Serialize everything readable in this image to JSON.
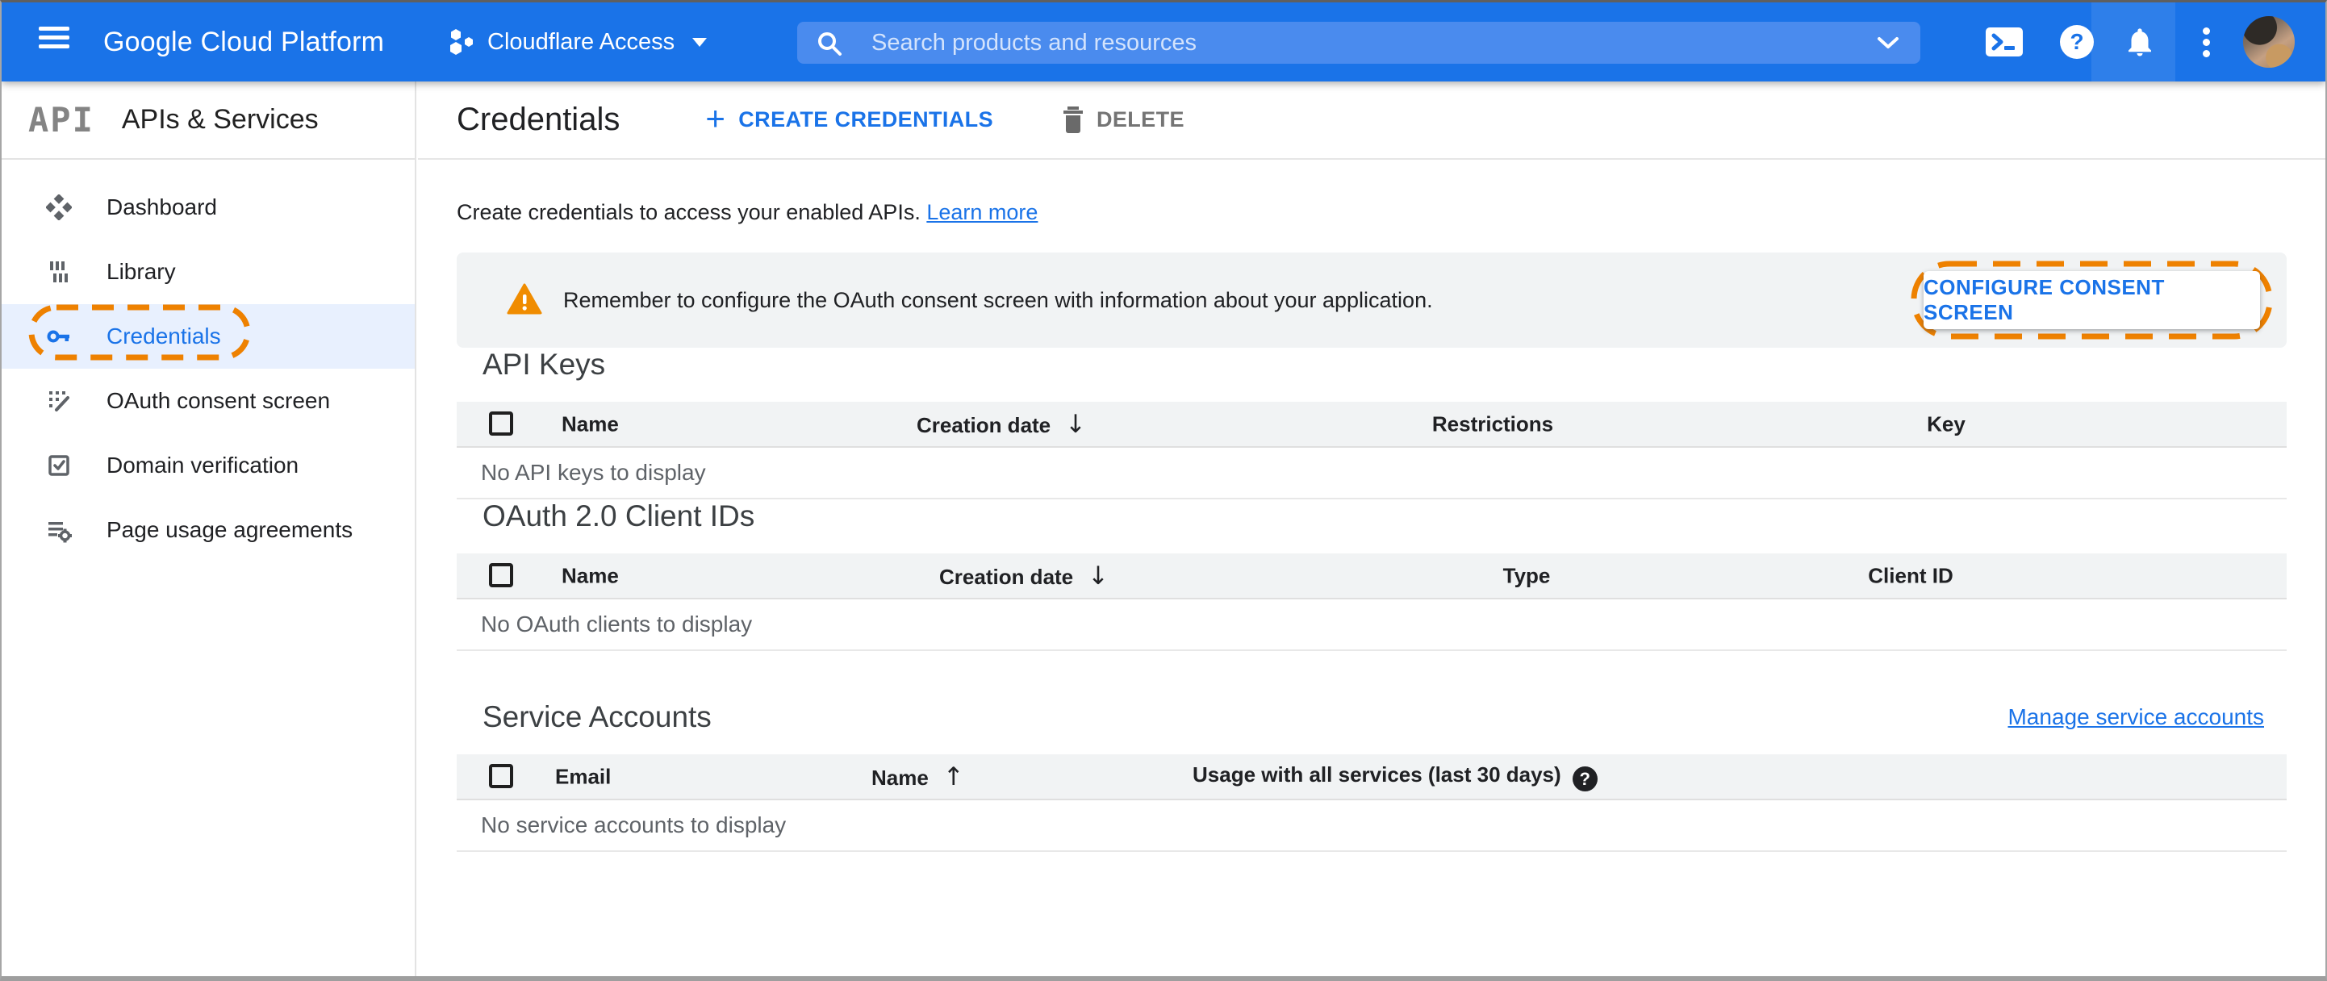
{
  "topbar": {
    "product": "Google Cloud Platform",
    "project_name": "Cloudflare Access",
    "search_placeholder": "Search products and resources"
  },
  "icons": {
    "plus": "+",
    "help": "?",
    "table_help": "?",
    "sort_desc": "↓",
    "sort_asc": "↑"
  },
  "sidebar": {
    "logo": "API",
    "title": "APIs & Services",
    "items": [
      {
        "label": "Dashboard"
      },
      {
        "label": "Library"
      },
      {
        "label": "Credentials"
      },
      {
        "label": "OAuth consent screen"
      },
      {
        "label": "Domain verification"
      },
      {
        "label": "Page usage agreements"
      }
    ]
  },
  "page": {
    "title": "Credentials",
    "create_button": "CREATE CREDENTIALS",
    "delete_button": "DELETE",
    "intro_text": "Create credentials to access your enabled APIs.",
    "intro_link": "Learn more",
    "banner_text": "Remember to configure the OAuth consent screen with information about your application.",
    "banner_button": "CONFIGURE CONSENT SCREEN"
  },
  "sections": {
    "api_keys": {
      "title": "API Keys",
      "col_name": "Name",
      "col_date": "Creation date",
      "col_restrictions": "Restrictions",
      "col_key": "Key",
      "empty": "No API keys to display"
    },
    "oauth": {
      "title": "OAuth 2.0 Client IDs",
      "col_name": "Name",
      "col_date": "Creation date",
      "col_type": "Type",
      "col_client_id": "Client ID",
      "empty": "No OAuth clients to display"
    },
    "service_accounts": {
      "title": "Service Accounts",
      "link": "Manage service accounts",
      "col_email": "Email",
      "col_name": "Name",
      "col_usage": "Usage with all services (last 30 days)",
      "empty": "No service accounts to display"
    }
  },
  "colors": {
    "topbar_blue": "#1a73e8",
    "accent_blue": "#1a73e8",
    "warning_orange": "#f08c00",
    "dashed_outline_orange": "#ee8100",
    "banner_bg": "#f1f3f4",
    "active_item_bg": "#e8f0fe"
  }
}
